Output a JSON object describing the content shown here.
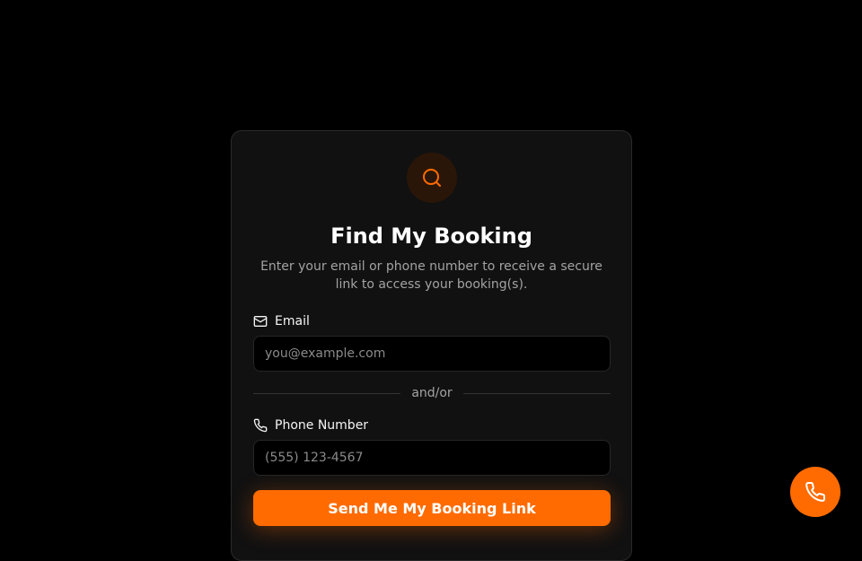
{
  "card": {
    "header_icon": "search-icon",
    "title": "Find My Booking",
    "subtitle": "Enter your email or phone number to receive a secure link to access your booking(s).",
    "email": {
      "icon": "mail-icon",
      "label": "Email",
      "value": "",
      "placeholder": "you@example.com"
    },
    "divider_text": "and/or",
    "phone": {
      "icon": "phone-icon",
      "label": "Phone Number",
      "value": "",
      "placeholder": "(555) 123-4567"
    },
    "submit_label": "Send Me My Booking Link"
  },
  "fab": {
    "icon": "phone-icon"
  },
  "colors": {
    "background": "#000000",
    "card": "#111111",
    "accent": "#ff6b00",
    "text_primary": "#ffffff",
    "text_secondary": "#a3a3a3"
  }
}
